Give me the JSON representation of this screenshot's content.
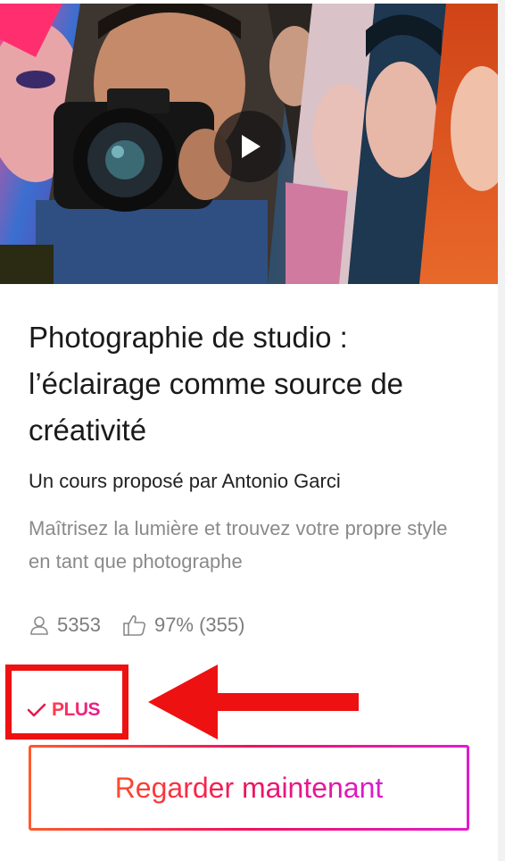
{
  "course": {
    "title": "Photographie de studio : l’éclairage comme source de créativité",
    "author": "Un cours proposé par Antonio Garci",
    "description": "Maîtrisez la lumière et trouvez votre propre style en tant que photographe",
    "students": "5353",
    "rating": "97% (355)"
  },
  "badge": {
    "label": "PLUS"
  },
  "cta": {
    "label": "Regarder maintenant"
  },
  "colors": {
    "annotation_red": "#ee1111",
    "gradient_start": "#ff4a2a",
    "gradient_mid": "#f0135f",
    "gradient_end": "#d91cd0"
  },
  "icons": {
    "video_play": "play-icon",
    "students": "user-icon",
    "rating": "thumbs-up-icon",
    "badge": "checkmark-icon",
    "annotation": "arrow-left-icon"
  }
}
